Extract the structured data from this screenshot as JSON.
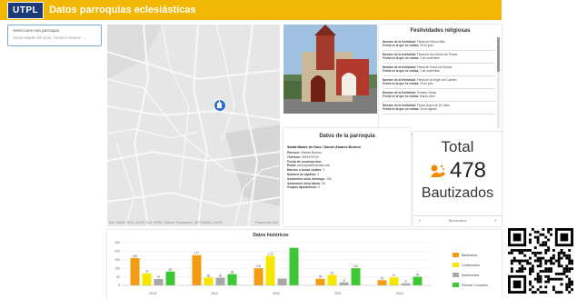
{
  "header": {
    "logo": "UTPL",
    "title": "Datos parroquias eclesiásticas"
  },
  "sidebar": {
    "select_label": "Seleccione una parroquia",
    "select_value": "Santa Madre de Dios / Daniel Álvarez ..."
  },
  "map": {
    "attribution": "Esri, NASA, NGA, USGS, Esri, HERE, Garmin, Foursquare, METI/NASA, USGS",
    "credit": "Powered by Esri"
  },
  "festividades": {
    "title": "Festividades religiosas",
    "items": [
      {
        "name_label": "Nombre de la festividad:",
        "name": "Fiesta del Divino Niño",
        "date_label": "Fecha en la que se realiza:",
        "date": "25 de julio"
      },
      {
        "name_label": "Nombre de la festividad:",
        "name": "Fiesta de San Martín de Porres",
        "date_label": "Fecha en la que se realiza:",
        "date": "3 de noviembre"
      },
      {
        "name_label": "Nombre de la festividad:",
        "name": "Fiesta de Todos los Santos",
        "date_label": "Fecha en la que se realiza:",
        "date": "1 de noviembre"
      },
      {
        "name_label": "Nombre de la festividad:",
        "name": "Fiesta de la Virgen del Carmen",
        "date_label": "Fecha en la que se realiza:",
        "date": "16 de julio"
      },
      {
        "name_label": "Nombre de la festividad:",
        "name": "Semana Santa",
        "date_label": "Fecha en la que se realiza:",
        "date": "Marzo-Abril"
      },
      {
        "name_label": "Nombre de la festividad:",
        "name": "Fiesta Virgen de El Cisne",
        "date_label": "Fecha en la que se realiza:",
        "date": "15 de agosto"
      }
    ]
  },
  "datos": {
    "title": "Datos de la parroquia",
    "name": "Santa Madre de Dios / Daniel Álvarez Burneo",
    "rows": [
      {
        "label": "Párroco:",
        "value": "Vicente Burneo"
      },
      {
        "label": "Teléfono:",
        "value": "0991579742"
      },
      {
        "label": "Fecha de construcción:",
        "value": ""
      },
      {
        "label": "Email:",
        "value": "parroquia@hotmail.com"
      },
      {
        "label": "Barrios o zonas totales:",
        "value": "2"
      },
      {
        "label": "Número de capillas:",
        "value": "2"
      },
      {
        "label": "Asistentes misa domingo:",
        "value": "150"
      },
      {
        "label": "Asistentes misa diario:",
        "value": "30"
      },
      {
        "label": "Grupos apostólicos:",
        "value": "3"
      }
    ]
  },
  "total": {
    "label": "Total",
    "value": "478",
    "caption": "Bautizados",
    "nav_label": "Bautizados",
    "prev": "‹",
    "next": "›",
    "icon_color": "#f08a00"
  },
  "historicos": {
    "title": "Datos históricos"
  },
  "chart_data": {
    "type": "bar",
    "categories": [
      "2018",
      "2019",
      "2020",
      "2021",
      "2022"
    ],
    "series": [
      {
        "name": "Bautizados",
        "color": "#f39c12",
        "values": [
          160,
          177,
          100,
          39,
          30
        ]
      },
      {
        "name": "Confirmados",
        "color": "#f7e600",
        "values": [
          70,
          46,
          173,
          61,
          47
        ]
      },
      {
        "name": "Matrimonios",
        "color": "#a8a8a8",
        "values": [
          37,
          45,
          40,
          17,
          12
        ]
      },
      {
        "name": "Primera Comunión",
        "color": "#3cc832",
        "values": [
          81,
          66,
          220,
          100,
          50
        ]
      }
    ],
    "data_labels": [
      [
        "160",
        "70",
        "37",
        "81"
      ],
      [
        "177",
        "46",
        "45",
        "66"
      ],
      [
        "100",
        "173",
        "",
        ""
      ],
      [
        "39",
        "61",
        "17",
        "100"
      ],
      [
        "30",
        "47",
        "12",
        "50"
      ]
    ],
    "ylim": [
      0,
      250
    ],
    "yticks": [
      "0",
      "50",
      "100",
      "150",
      "200",
      "250"
    ],
    "legend_position": "right",
    "grid": true
  }
}
